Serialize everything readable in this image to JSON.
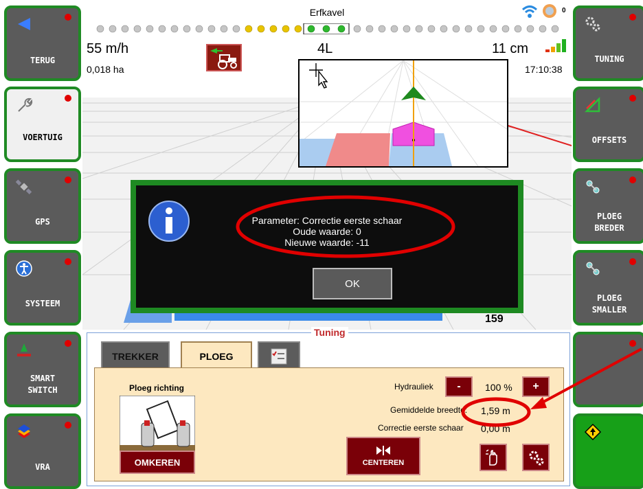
{
  "left_sidebar": [
    {
      "label": "TERUG",
      "icon": "back-arrow-icon"
    },
    {
      "label": "VOERTUIG",
      "icon": "wrench-icon"
    },
    {
      "label": "GPS",
      "icon": "satellite-icon"
    },
    {
      "label": "SYSTEEM",
      "icon": "accessibility-icon"
    },
    {
      "label": "SMART\nSWITCH",
      "icon": "smart-switch-icon"
    },
    {
      "label": "VRA",
      "icon": "vra-layers-icon"
    }
  ],
  "right_sidebar": [
    {
      "label": "TUNING",
      "icon": "gears-icon"
    },
    {
      "label": "OFFSETS",
      "icon": "ruler-triangle-icon"
    },
    {
      "label": "PLOEG\nBREDER",
      "icon": "plough-wider-icon"
    },
    {
      "label": "PLOEG\nSMALLER",
      "icon": "plough-narrower-icon"
    },
    {
      "label": "",
      "icon": ""
    },
    {
      "label": "",
      "icon": "warning-diamond-icon"
    }
  ],
  "status_bar": {
    "title": "Erfkavel",
    "speed": "55 m/h",
    "area": "0,018 ha",
    "gear": "4L",
    "offset": "11 cm",
    "time": "17:10:38",
    "satellite_count": "0"
  },
  "colors": {
    "sidebar_bg": "#5b5b5b",
    "sidebar_border": "#1f8a24",
    "dialog_bg": "#0d0d0d",
    "dialog_border": "#1e8a22",
    "tuning_accent": "#c0282a",
    "panel_bg": "#fde8c0",
    "button_red": "#7a0008"
  },
  "dialog": {
    "line1": "Parameter: Correctie eerste schaar",
    "line2": "Oude waarde: 0",
    "line3": "Nieuwe waarde: -11",
    "ok_label": "OK"
  },
  "map_bottom_value": "159",
  "tuning": {
    "title": "Tuning",
    "tabs": [
      "TREKKER",
      "PLOEG"
    ],
    "ploeg_richting": "Ploeg richting",
    "omkeren": "OMKEREN",
    "centeren": "CENTEREN",
    "hydrauliek_label": "Hydrauliek",
    "hydrauliek_value": "100 %",
    "minus": "-",
    "plus": "+",
    "gem_breedte_label": "Gemiddelde breedte:",
    "gem_breedte_value": "1,59 m",
    "correctie_label": "Correctie eerste schaar",
    "correctie_value": "0,00 m"
  }
}
